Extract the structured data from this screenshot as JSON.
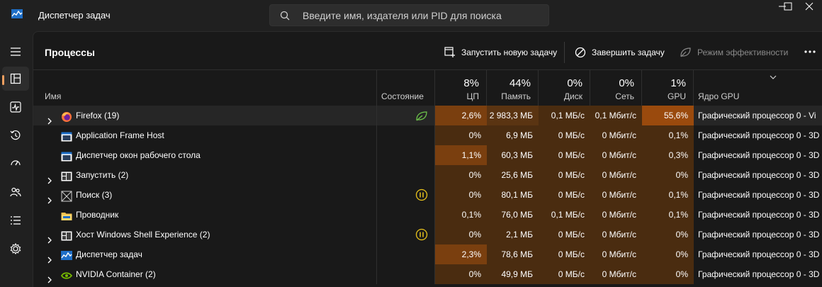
{
  "app": {
    "title": "Диспетчер задач"
  },
  "search": {
    "placeholder": "Введите имя, издателя или PID для поиска"
  },
  "window_controls": [
    "minimize-icon",
    "maximize-icon",
    "close-icon"
  ],
  "nav": {
    "items": [
      {
        "icon": "hamburger-menu-icon"
      },
      {
        "icon": "processes-icon",
        "active": true
      },
      {
        "icon": "performance-icon"
      },
      {
        "icon": "app-history-icon"
      },
      {
        "icon": "startup-apps-icon"
      },
      {
        "icon": "users-icon"
      },
      {
        "icon": "details-icon"
      },
      {
        "icon": "services-icon"
      }
    ],
    "accent_color": "#f0a060"
  },
  "toolbar": {
    "title": "Процессы",
    "run_task_label": "Запустить новую задачу",
    "end_task_label": "Завершить задачу",
    "efficiency_label": "Режим эффективности"
  },
  "columns": {
    "name": "Имя",
    "status": "Состояние",
    "cpu": {
      "pct": "8%",
      "label": "ЦП"
    },
    "memory": {
      "pct": "44%",
      "label": "Память"
    },
    "disk": {
      "pct": "0%",
      "label": "Диск"
    },
    "network": {
      "pct": "0%",
      "label": "Сеть"
    },
    "gpu": {
      "pct": "1%",
      "label": "GPU"
    },
    "gpu_engine": "Ядро GPU"
  },
  "rows": [
    {
      "name": "Firefox (19)",
      "expandable": true,
      "icon": "firefox-icon",
      "status_icon": "eco-leaf-icon",
      "cpu": "2,6%",
      "mem": "2 983,3 МБ",
      "disk": "0,1 МБ/с",
      "net": "0,1 Мбит/с",
      "gpu": "55,6%",
      "engine": "Графический процессор 0 - Vi"
    },
    {
      "name": "Application Frame Host",
      "expandable": false,
      "icon": "app-window-icon",
      "status_icon": "",
      "cpu": "0%",
      "mem": "6,9 МБ",
      "disk": "0 МБ/с",
      "net": "0 Мбит/с",
      "gpu": "0,1%",
      "engine": "Графический процессор 0 - 3D"
    },
    {
      "name": "Диспетчер окон рабочего стола",
      "expandable": false,
      "icon": "app-window-icon",
      "status_icon": "",
      "cpu": "1,1%",
      "mem": "60,3 МБ",
      "disk": "0 МБ/с",
      "net": "0 Мбит/с",
      "gpu": "0,3%",
      "engine": "Графический процессор 0 - 3D"
    },
    {
      "name": "Запустить (2)",
      "expandable": true,
      "icon": "run-window-icon",
      "status_icon": "",
      "cpu": "0%",
      "mem": "25,6 МБ",
      "disk": "0 МБ/с",
      "net": "0 Мбит/с",
      "gpu": "0%",
      "engine": "Графический процессор 0 - 3D"
    },
    {
      "name": "Поиск (3)",
      "expandable": true,
      "icon": "search-app-icon",
      "status_icon": "suspended-icon",
      "cpu": "0%",
      "mem": "80,1 МБ",
      "disk": "0 МБ/с",
      "net": "0 Мбит/с",
      "gpu": "0,1%",
      "engine": "Графический процессор 0 - 3D"
    },
    {
      "name": "Проводник",
      "expandable": false,
      "icon": "folder-icon",
      "status_icon": "",
      "cpu": "0,1%",
      "mem": "76,0 МБ",
      "disk": "0,1 МБ/с",
      "net": "0 Мбит/с",
      "gpu": "0,1%",
      "engine": "Графический процессор 0 - 3D"
    },
    {
      "name": "Хост Windows Shell Experience (2)",
      "expandable": true,
      "icon": "run-window-icon",
      "status_icon": "suspended-icon",
      "cpu": "0%",
      "mem": "2,1 МБ",
      "disk": "0 МБ/с",
      "net": "0 Мбит/с",
      "gpu": "0%",
      "engine": "Графический процессор 0 - 3D"
    },
    {
      "name": "Диспетчер задач",
      "expandable": true,
      "icon": "task-manager-icon",
      "status_icon": "",
      "cpu": "2,3%",
      "mem": "78,6 МБ",
      "disk": "0 МБ/с",
      "net": "0 Мбит/с",
      "gpu": "0%",
      "engine": "Графический процессор 0 - 3D"
    },
    {
      "name": "NVIDIA Container (2)",
      "expandable": true,
      "icon": "nvidia-icon",
      "status_icon": "",
      "cpu": "0%",
      "mem": "49,9 МБ",
      "disk": "0 МБ/с",
      "net": "0 Мбит/с",
      "gpu": "0%",
      "engine": "Графический процессор 0 - 3D"
    }
  ]
}
